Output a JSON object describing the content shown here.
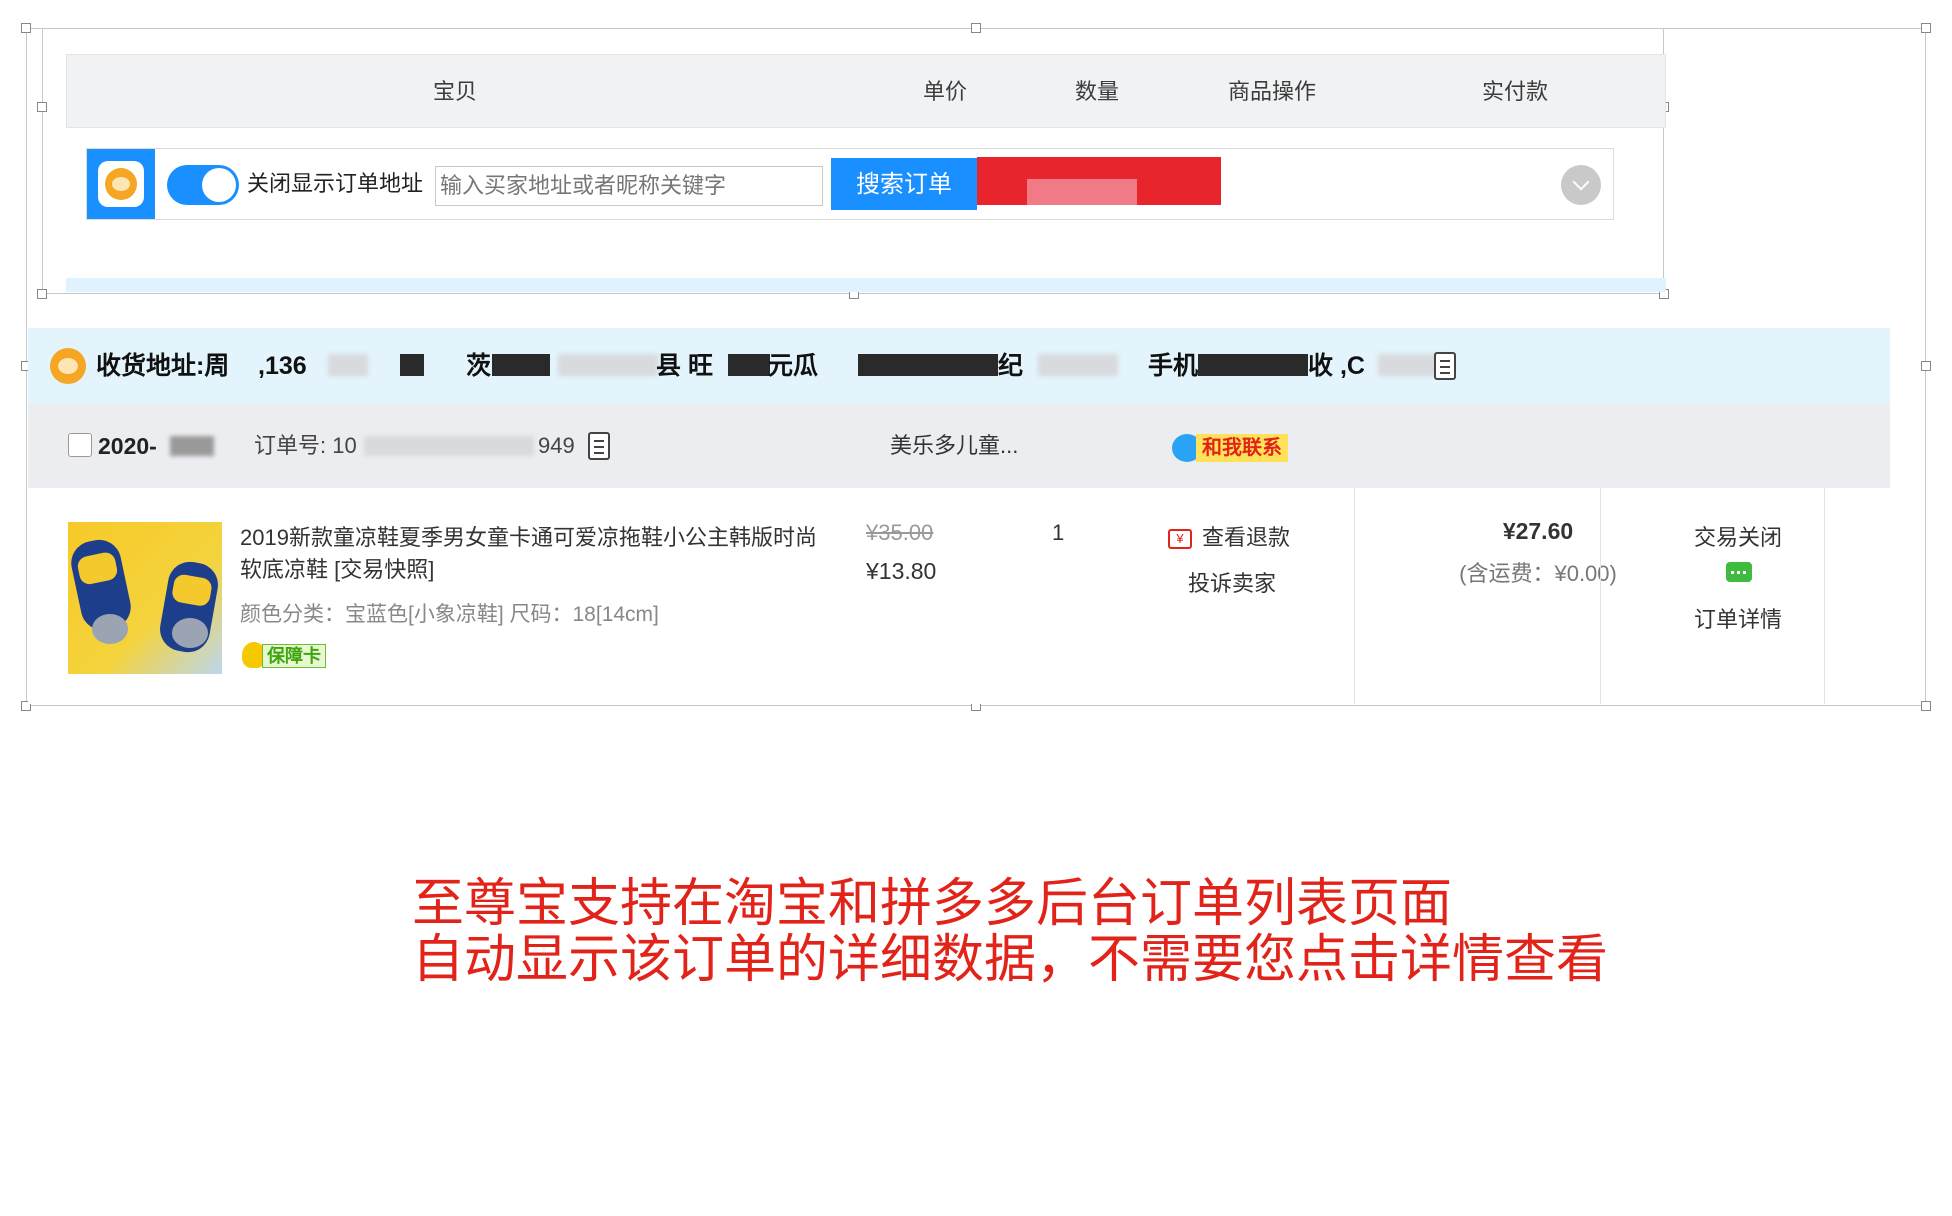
{
  "table_header": {
    "columns": [
      "宝贝",
      "单价",
      "数量",
      "商品操作",
      "实付款"
    ]
  },
  "toolbar": {
    "toggle_label": "关闭显示订单地址",
    "toggle_on": true,
    "search_placeholder": "输入买家地址或者昵称关键字",
    "search_button": "搜索订单",
    "accent_color": "#1a8fff"
  },
  "address": {
    "label": "收货地址:周",
    "visible_fragments": [
      ",136",
      "茨",
      "县 旺",
      "元瓜",
      "纪",
      "手机",
      "收 ,C"
    ]
  },
  "order": {
    "date_prefix": "2020-",
    "order_no_label": "订单号: 10",
    "order_no_tail": "949",
    "shop_name": "美乐多儿童...",
    "contact_label": "和我联系"
  },
  "item": {
    "title": "2019新款童凉鞋夏季男女童卡通可爱凉拖鞋小公主韩版时尚软底凉鞋 [交易快照]",
    "spec": "颜色分类：宝蓝色[小象凉鞋]  尺码：18[14cm]",
    "badge": "保障卡",
    "original_price": "¥35.00",
    "price": "¥13.80",
    "quantity": "1",
    "refund_icon": "¥",
    "refund_label": "查看退款",
    "complain_label": "投诉卖家",
    "total": "¥27.60",
    "shipping": "(含运费：¥0.00)",
    "status": "交易关闭",
    "detail_label": "订单详情"
  },
  "caption": {
    "line1": "至尊宝支持在淘宝和拼多多后台订单列表页面",
    "line2": "自动显示该订单的详细数据，不需要您点击详情查看",
    "color": "#e2231a"
  }
}
